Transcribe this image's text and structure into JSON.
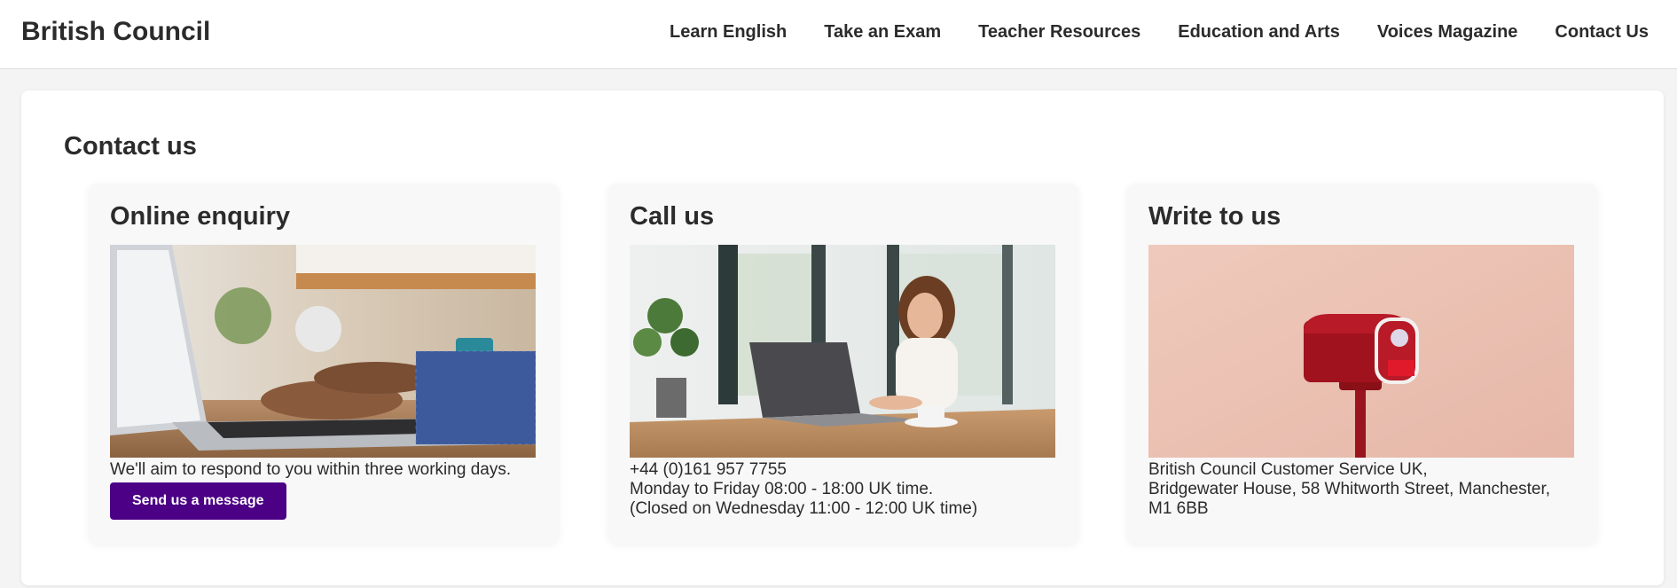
{
  "header": {
    "brand": "British Council",
    "nav": [
      "Learn English",
      "Take an Exam",
      "Teacher Resources",
      "Education and Arts",
      "Voices Magazine",
      "Contact Us"
    ]
  },
  "main": {
    "title": "Contact us",
    "columns": [
      {
        "heading": "Online enquiry",
        "lines": [
          "We'll aim to respond to you within three working days."
        ],
        "button": "Send us a message"
      },
      {
        "heading": "Call us",
        "lines": [
          "+44 (0)161 957 7755",
          "Monday to Friday 08:00 - 18:00 UK time.",
          "(Closed on Wednesday 11:00 - 12:00 UK time)"
        ]
      },
      {
        "heading": "Write to us",
        "lines": [
          "British Council Customer Service UK,",
          "Bridgewater House, 58 Whitworth Street, Manchester,",
          "M1 6BB"
        ]
      }
    ]
  },
  "colors": {
    "button": "#4b0085",
    "text": "#2b2b2b",
    "card_bg": "#f8f8f8"
  },
  "images": {
    "online_enquiry": "laptop-typing-photo",
    "call_us": "woman-at-laptop-photo",
    "write_to_us": "red-mailbox-photo"
  }
}
